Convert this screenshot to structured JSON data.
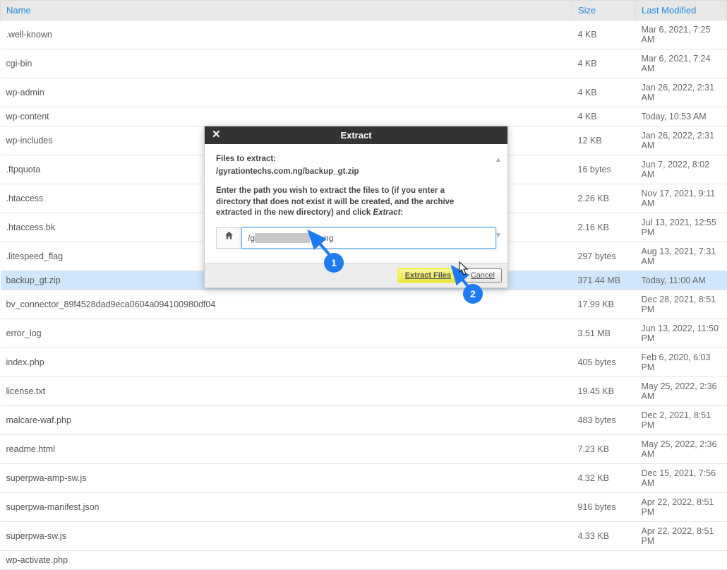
{
  "columns": {
    "name": "Name",
    "size": "Size",
    "modified": "Last Modified"
  },
  "rows": [
    {
      "name": ".well-known",
      "size": "4 KB",
      "modified": "Mar 6, 2021, 7:25 AM"
    },
    {
      "name": "cgi-bin",
      "size": "4 KB",
      "modified": "Mar 6, 2021, 7:24 AM"
    },
    {
      "name": "wp-admin",
      "size": "4 KB",
      "modified": "Jan 26, 2022, 2:31 AM"
    },
    {
      "name": "wp-content",
      "size": "4 KB",
      "modified": "Today, 10:53 AM"
    },
    {
      "name": "wp-includes",
      "size": "12 KB",
      "modified": "Jan 26, 2022, 2:31 AM"
    },
    {
      "name": ".ftpquota",
      "size": "16 bytes",
      "modified": "Jun 7, 2022, 8:02 AM"
    },
    {
      "name": ".htaccess",
      "size": "2.26 KB",
      "modified": "Nov 17, 2021, 9:11 AM"
    },
    {
      "name": ".htaccess.bk",
      "size": "2.16 KB",
      "modified": "Jul 13, 2021, 12:55 PM"
    },
    {
      "name": ".litespeed_flag",
      "size": "297 bytes",
      "modified": "Aug 13, 2021, 7:31 AM"
    },
    {
      "name": "backup_gt.zip",
      "size": "371.44 MB",
      "modified": "Today, 11:00 AM",
      "selected": true
    },
    {
      "name": "bv_connector_89f4528dad9eca0604a094100980df04",
      "size": "17.99 KB",
      "modified": "Dec 28, 2021, 8:51 PM"
    },
    {
      "name": "error_log",
      "size": "3.51 MB",
      "modified": "Jun 13, 2022, 11:50 PM"
    },
    {
      "name": "index.php",
      "size": "405 bytes",
      "modified": "Feb 6, 2020, 6:03 PM"
    },
    {
      "name": "license.txt",
      "size": "19.45 KB",
      "modified": "May 25, 2022, 2:36 AM"
    },
    {
      "name": "malcare-waf.php",
      "size": "483 bytes",
      "modified": "Dec 2, 2021, 8:51 PM"
    },
    {
      "name": "readme.html",
      "size": "7.23 KB",
      "modified": "May 25, 2022, 2:36 AM"
    },
    {
      "name": "superpwa-amp-sw.js",
      "size": "4.32 KB",
      "modified": "Dec 15, 2021, 7:56 AM"
    },
    {
      "name": "superpwa-manifest.json",
      "size": "916 bytes",
      "modified": "Apr 22, 2022, 8:51 PM"
    },
    {
      "name": "superpwa-sw.js",
      "size": "4.33 KB",
      "modified": "Apr 22, 2022, 8:51 PM"
    },
    {
      "name": "wp-activate.php",
      "size": "",
      "modified": ""
    }
  ],
  "dialog": {
    "title": "Extract",
    "files_label": "Files to extract:",
    "files_path": "/gyrationtechs.com.ng/backup_gt.zip",
    "instruction_pre": "Enter the path you wish to extract the files to (if you enter a directory that does not exist it will be created, and the archive extracted in the new directory) and click ",
    "instruction_em": "Extract",
    "instruction_post": ":",
    "input_prefix": "/g",
    "input_suffix": "om.ng",
    "extract_btn": "Extract Files",
    "cancel_btn": "Cancel"
  },
  "annotations": {
    "badge1": "1",
    "badge2": "2"
  }
}
